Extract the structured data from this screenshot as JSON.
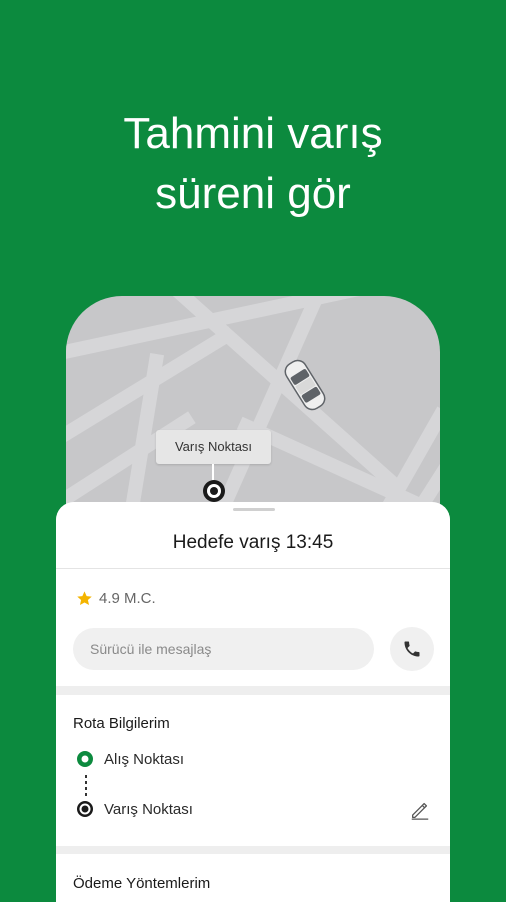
{
  "headline": {
    "line1": "Tahmini varış",
    "line2": "süreni gör"
  },
  "map": {
    "destination_label": "Varış Noktası"
  },
  "sheet": {
    "eta_text": "Hedefe varış 13:45",
    "rating": "4.9 M.C.",
    "message_placeholder": "Sürücü ile mesajlaş",
    "route": {
      "title": "Rota Bilgilerim",
      "pickup_label": "Alış Noktası",
      "destination_label": "Varış Noktası"
    },
    "payment": {
      "title": "Ödeme Yöntemlerim"
    }
  },
  "icons": {
    "star": "star-icon",
    "phone": "phone-icon",
    "edit": "pencil-icon",
    "car": "car-icon",
    "pin": "destination-pin-icon"
  },
  "colors": {
    "brand_green": "#0c8a3e",
    "star": "#f4b400",
    "pickup_ring": "#0c8a3e",
    "map_bg": "#c7c7c9",
    "map_roads": "#d6d6d8"
  }
}
